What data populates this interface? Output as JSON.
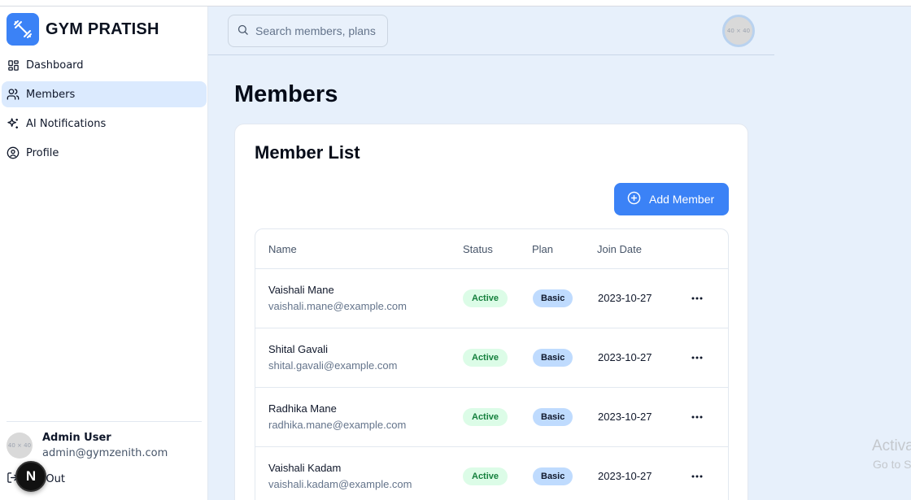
{
  "brand": {
    "name": "GYM PRATISH",
    "logo_icon": "dumbbell-icon",
    "accent": "#3b82f6"
  },
  "sidebar": {
    "items": [
      {
        "label": "Dashboard",
        "icon": "dashboard-icon",
        "active": false
      },
      {
        "label": "Members",
        "icon": "users-icon",
        "active": true
      },
      {
        "label": "AI Notifications",
        "icon": "sparkles-icon",
        "active": false
      },
      {
        "label": "Profile",
        "icon": "user-circle-icon",
        "active": false
      }
    ],
    "user": {
      "name": "Admin User",
      "email": "admin@gymzenith.com",
      "avatar_text": "40 × 40"
    },
    "logout_label": "Log Out",
    "next_badge": "N"
  },
  "header": {
    "search_placeholder": "Search members, plans",
    "avatar_text": "40 × 40"
  },
  "page": {
    "title": "Members",
    "card_title": "Member List",
    "add_button": "Add Member"
  },
  "table": {
    "headers": {
      "name": "Name",
      "status": "Status",
      "plan": "Plan",
      "join_date": "Join Date"
    },
    "rows": [
      {
        "name": "Vaishali Mane",
        "email": "vaishali.mane@example.com",
        "status": "Active",
        "plan": "Basic",
        "join_date": "2023-10-27"
      },
      {
        "name": "Shital Gavali",
        "email": "shital.gavali@example.com",
        "status": "Active",
        "plan": "Basic",
        "join_date": "2023-10-27"
      },
      {
        "name": "Radhika Mane",
        "email": "radhika.mane@example.com",
        "status": "Active",
        "plan": "Basic",
        "join_date": "2023-10-27"
      },
      {
        "name": "Vaishali Kadam",
        "email": "vaishali.kadam@example.com",
        "status": "Active",
        "plan": "Basic",
        "join_date": "2023-10-27"
      }
    ]
  },
  "watermark": {
    "title": "Activa",
    "subtitle": "Go to S"
  },
  "colors": {
    "status_active_bg": "#dcfce7",
    "status_active_text": "#15803d",
    "plan_bg": "#bfdbfe",
    "main_bg": "#e7f0fb"
  }
}
